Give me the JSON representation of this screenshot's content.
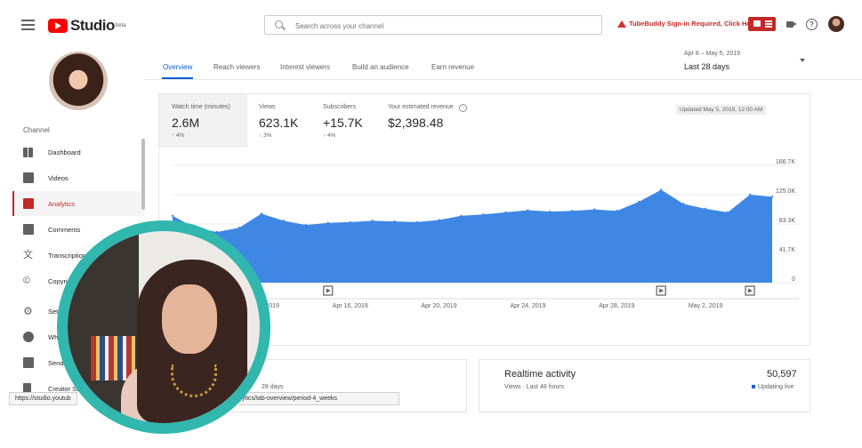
{
  "header": {
    "logo_text": "Studio",
    "logo_badge": "beta",
    "search_placeholder": "Search across your channel",
    "tubebuddy_warning": "TubeBuddy Sign-in Required, Click Here",
    "help_glyph": "?"
  },
  "sidebar": {
    "section_label": "Channel",
    "items": [
      {
        "label": "Dashboard",
        "icon": "dashboard-icon"
      },
      {
        "label": "Videos",
        "icon": "videos-icon"
      },
      {
        "label": "Analytics",
        "icon": "analytics-icon",
        "active": true
      },
      {
        "label": "Comments",
        "icon": "comments-icon"
      },
      {
        "label": "Transcriptions",
        "icon": "translate-icon"
      },
      {
        "label": "Copyright",
        "icon": "copyright-icon"
      },
      {
        "label": "Settings",
        "icon": "gear-icon"
      },
      {
        "label": "What's new",
        "icon": "whats-new-icon"
      },
      {
        "label": "Send feedback",
        "icon": "feedback-icon"
      },
      {
        "label": "Creator Studio Classic",
        "icon": "classic-icon"
      }
    ]
  },
  "tabs": [
    "Overview",
    "Reach viewers",
    "Interest viewers",
    "Build an audience",
    "Earn revenue"
  ],
  "date_picker": {
    "range": "Apr 8 – May 5, 2019",
    "label": "Last 28 days"
  },
  "metrics": [
    {
      "label": "Watch time (minutes)",
      "value": "2.6M",
      "change": "↑ 4%"
    },
    {
      "label": "Views",
      "value": "623.1K",
      "change": "↑ 3%"
    },
    {
      "label": "Subscribers",
      "value": "+15.7K",
      "change": "↑ 4%"
    },
    {
      "label": "Your estimated revenue",
      "value": "$2,398.48",
      "change": ""
    }
  ],
  "info_glyph": "i",
  "updated_text": "Updated May 5, 2019, 12:00 AM",
  "chart_data": {
    "type": "area",
    "x": [
      "Apr 8",
      "Apr 9",
      "Apr 10",
      "Apr 11",
      "Apr 12",
      "Apr 13",
      "Apr 14",
      "Apr 15",
      "Apr 16",
      "Apr 17",
      "Apr 18",
      "Apr 19",
      "Apr 20",
      "Apr 21",
      "Apr 22",
      "Apr 23",
      "Apr 24",
      "Apr 25",
      "Apr 26",
      "Apr 27",
      "Apr 28",
      "Apr 29",
      "Apr 30",
      "May 1",
      "May 2",
      "May 3",
      "May 4",
      "May 5"
    ],
    "series": [
      {
        "values": [
          95000,
          78000,
          72000,
          78000,
          98000,
          88000,
          82000,
          85000,
          86000,
          88000,
          87000,
          86000,
          89000,
          95000,
          97000,
          100000,
          103000,
          101000,
          102000,
          104000,
          102000,
          115000,
          132000,
          112000,
          105000,
          100000,
          125000,
          122000
        ]
      }
    ],
    "xtick_labels": [
      "Apr 12, 2019",
      "Apr 16, 2019",
      "Apr 20, 2019",
      "Apr 24, 2019",
      "Apr 28, 2019",
      "May 2, 2019"
    ],
    "ytick_labels": [
      "0",
      "41.7K",
      "83.3K",
      "125.0K",
      "166.7K"
    ],
    "ylim": [
      0,
      166700
    ],
    "color": "#3f87e5"
  },
  "realtime": {
    "title": "Realtime activity",
    "subtitle": "Views · Last 48 hours",
    "value": "50,597",
    "status": "Updating live"
  },
  "partial_label": "28 days",
  "status_bar": {
    "left": "https://studio.youtub",
    "right": "ytics/tab-overview/period-4_weeks"
  }
}
